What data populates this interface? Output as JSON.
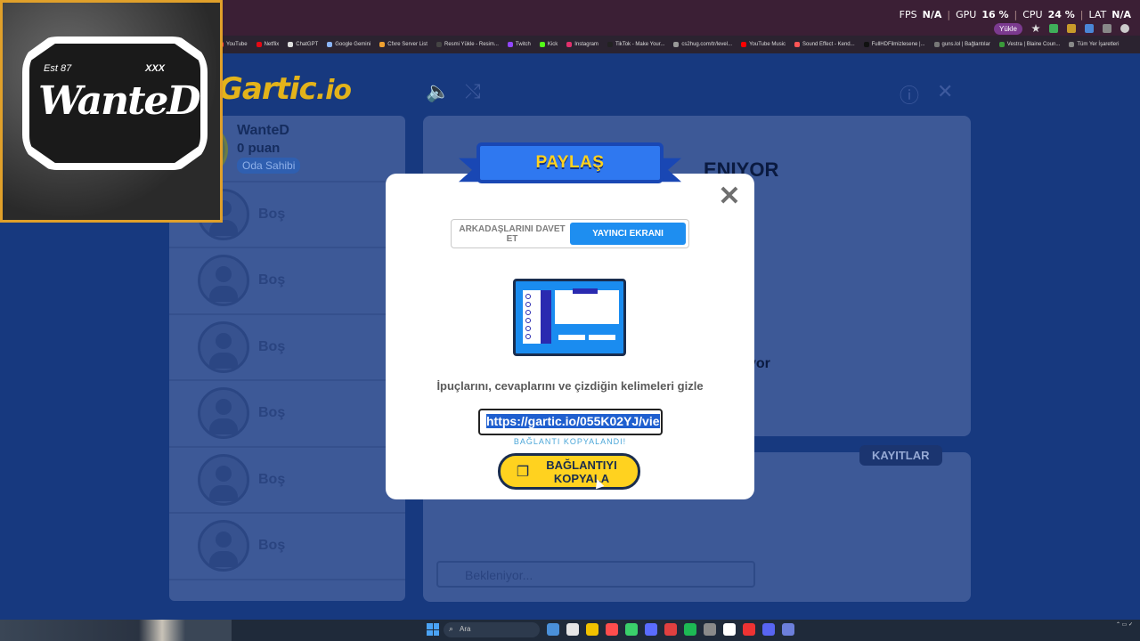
{
  "browser": {
    "perf": [
      {
        "label": "FPS",
        "value": "N/A"
      },
      {
        "label": "GPU",
        "value": "16 %"
      },
      {
        "label": "CPU",
        "value": "24 %"
      },
      {
        "label": "LAT",
        "value": "N/A"
      }
    ],
    "upload_pill": "Yükle",
    "bookmarks": [
      {
        "label": "YouTube",
        "color": "#ff3b3b"
      },
      {
        "label": "Netflix",
        "color": "#e50914"
      },
      {
        "label": "ChatGPT",
        "color": "#dddddd"
      },
      {
        "label": "Google Gemini",
        "color": "#8ab4f8"
      },
      {
        "label": "Cfxre Server List",
        "color": "#f0a030"
      },
      {
        "label": "Resmi Yükle - Resim...",
        "color": "#444444"
      },
      {
        "label": "Twitch",
        "color": "#9146ff"
      },
      {
        "label": "Kick",
        "color": "#53fc18"
      },
      {
        "label": "Instagram",
        "color": "#e1306c"
      },
      {
        "label": "TikTok - Make Your...",
        "color": "#222222"
      },
      {
        "label": "cs2hug.com/tr/level...",
        "color": "#999999"
      },
      {
        "label": "YouTube Music",
        "color": "#ff0000"
      },
      {
        "label": "Sound Effect - Kend...",
        "color": "#ff5555"
      },
      {
        "label": "FullHDFilmizlesene |...",
        "color": "#111111"
      },
      {
        "label": "guns.lol | Bağlantılar",
        "color": "#777777"
      },
      {
        "label": "Vestra | Blaine Coun...",
        "color": "#3a9a3a"
      },
      {
        "label": "Tüm Yer İşaretleri",
        "color": "#888888"
      }
    ]
  },
  "game": {
    "logo_main": "Gartic",
    "logo_suffix": ".io",
    "players": [
      {
        "name": "WanteD",
        "points": "0 puan",
        "badge": "Oda Sahibi"
      },
      {
        "name": "Boş"
      },
      {
        "name": "Boş"
      },
      {
        "name": "Boş"
      },
      {
        "name": "Boş"
      },
      {
        "name": "Boş"
      },
      {
        "name": "Boş"
      }
    ],
    "waiting_partial": "ENIYOR",
    "waiting_sub_partial": "yor",
    "records_tab": "KAYITLAR",
    "chat_placeholder": "Bekleniyor..."
  },
  "modal": {
    "title": "PAYLAŞ",
    "close_symbol": "✕",
    "tabs": [
      {
        "label": "ARKADAŞLARINI DAVET ET",
        "active": false
      },
      {
        "label": "YAYINCI EKRANI",
        "active": true
      }
    ],
    "description": "İpuçlarını, cevaplarını ve çizdiğin kelimeleri gizle",
    "url": "https://gartic.io/055K02YJ/vie",
    "copied_status": "BAĞLANTI KOPYALANDI!",
    "copy_button": "BAĞLANTIYI KOPYALA"
  },
  "webcam": {
    "word": "WanteD",
    "left_mark": "Est 87",
    "right_mark": "XXX"
  },
  "taskbar": {
    "search_placeholder": "Ara",
    "app_colors": [
      "#4a90d9",
      "#e6e6e6",
      "#f2c200",
      "#ff4d4d",
      "#3ad06b",
      "#5a6cff",
      "#e04040",
      "#1db954",
      "#8a8a8a",
      "#ffffff",
      "#e33",
      "#5865f2",
      "#6c7fdb"
    ]
  },
  "colors": {
    "modal_accent": "#1e8ef0",
    "copy_button": "#ffd21f",
    "ribbon": "#2f78f0"
  }
}
